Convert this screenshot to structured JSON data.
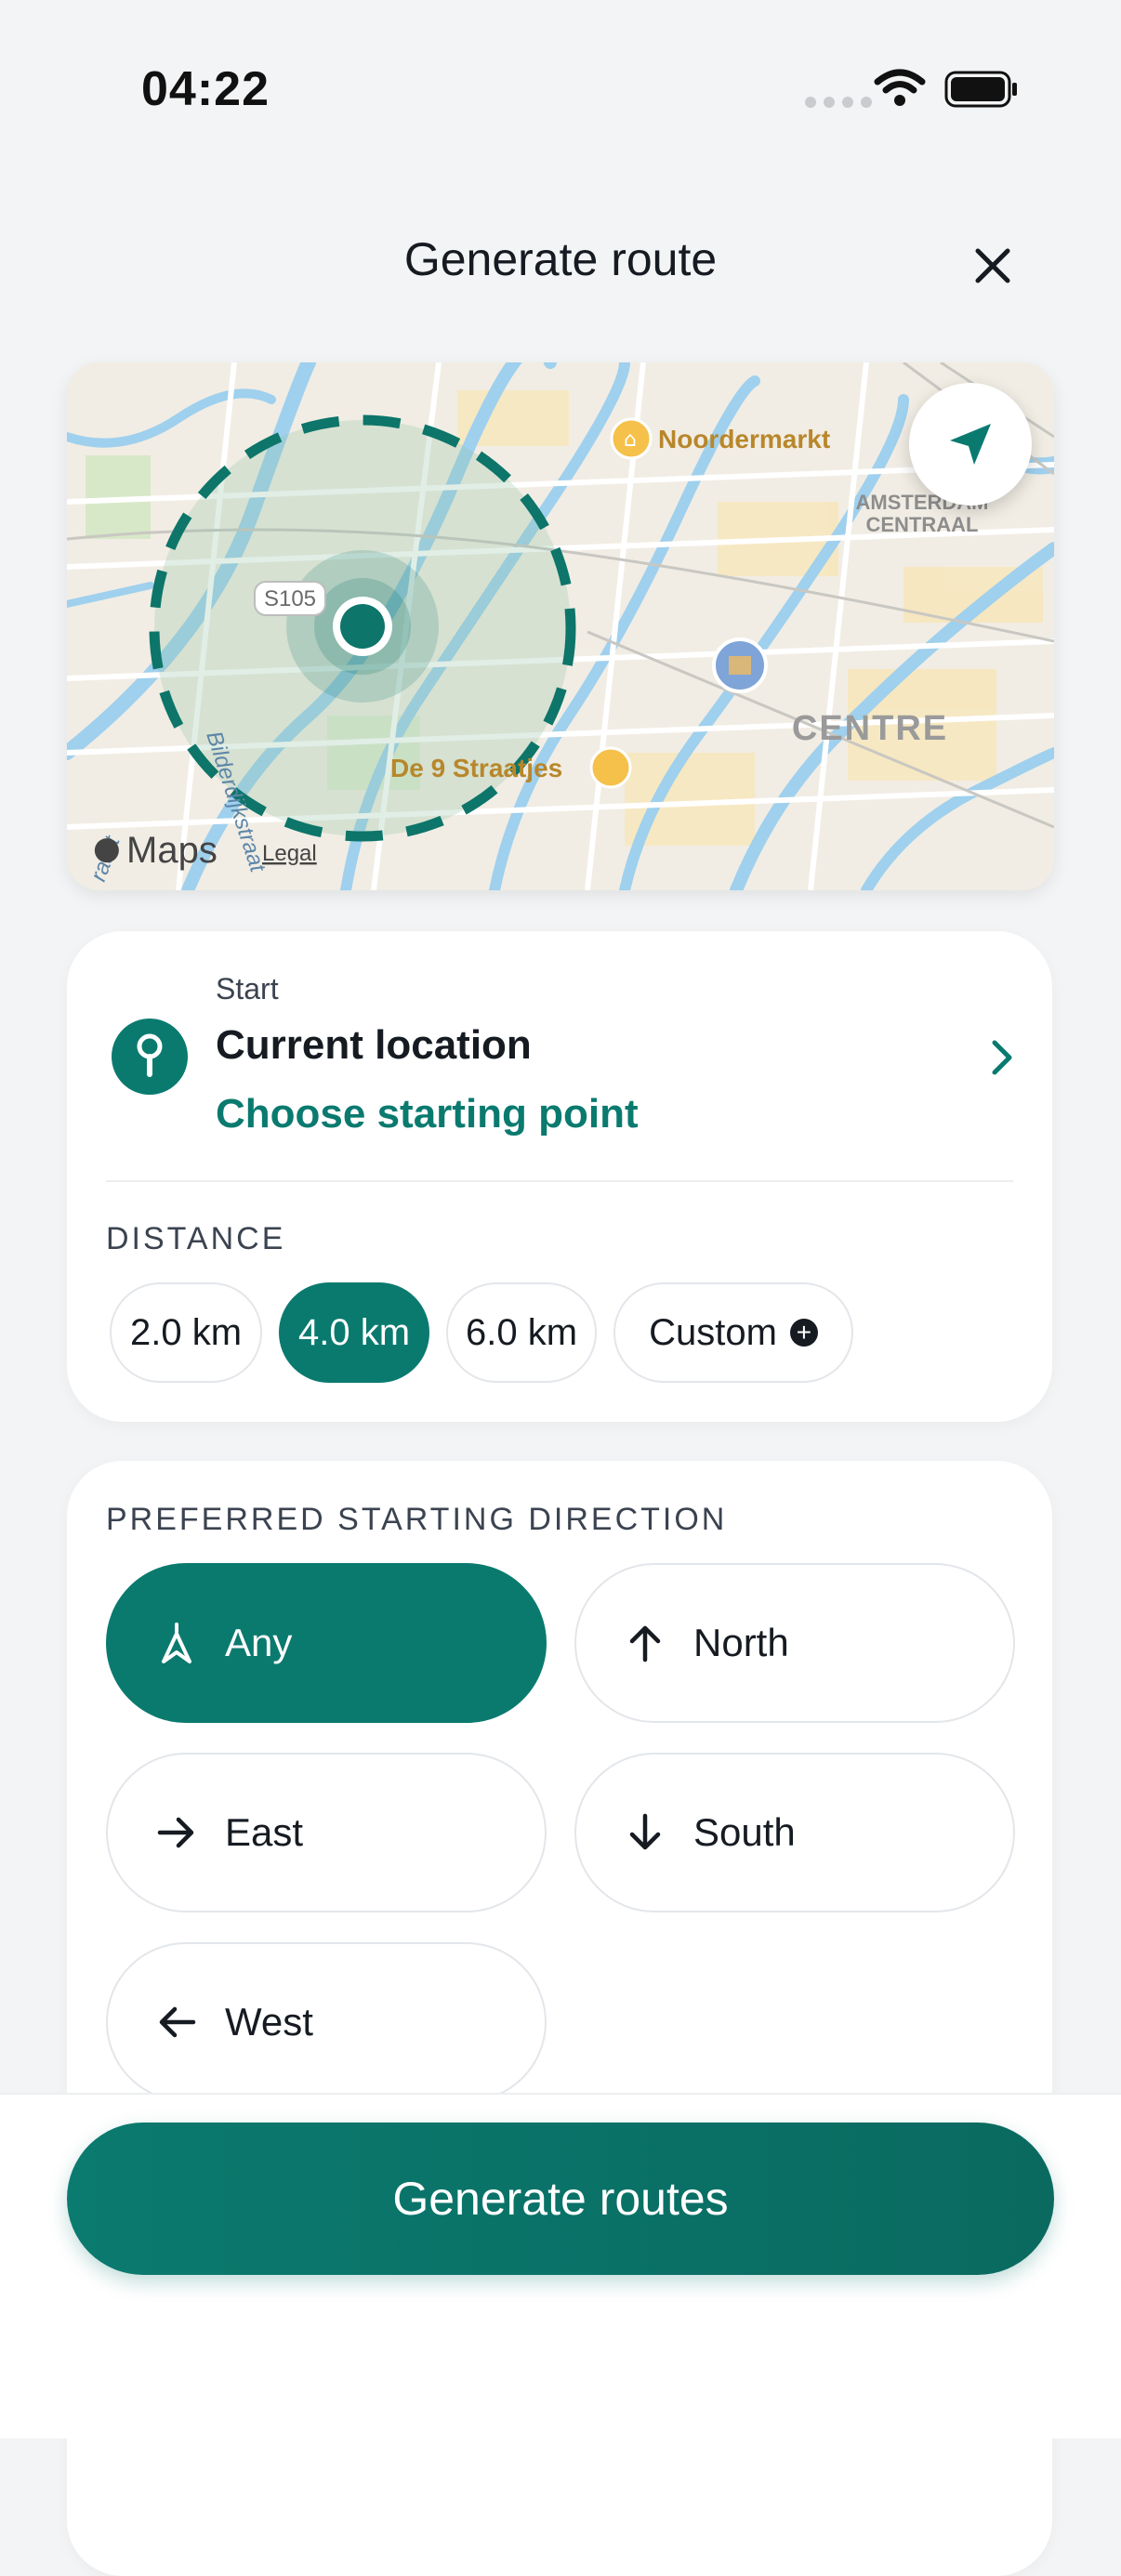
{
  "status_bar": {
    "time": "04:22"
  },
  "header": {
    "title": "Generate route"
  },
  "map": {
    "labels": {
      "noordermarkt": "Noordermarkt",
      "amsterdam_centraal_1": "AMSTERDAM",
      "amsterdam_centraal_2": "CENTRAAL",
      "centre": "CENTRE",
      "de9straatjes": "De 9 Straatjes",
      "road_shield": "S105",
      "street_1": "Bilderdijkstraat",
      "street_2": "raart",
      "maps_brand": "Maps",
      "legal": "Legal"
    }
  },
  "start": {
    "label": "Start",
    "value": "Current location",
    "link": "Choose starting point"
  },
  "distance": {
    "label": "DISTANCE",
    "options": [
      "2.0 km",
      "4.0 km",
      "6.0 km",
      "Custom"
    ],
    "selected": "4.0 km"
  },
  "direction": {
    "label": "PREFERRED STARTING DIRECTION",
    "options": {
      "any": "Any",
      "north": "North",
      "east": "East",
      "south": "South",
      "west": "West"
    },
    "selected": "Any"
  },
  "footer": {
    "button": "Generate routes"
  },
  "colors": {
    "accent": "#0a7a6f",
    "text": "#161b22",
    "muted": "#3b4350"
  }
}
